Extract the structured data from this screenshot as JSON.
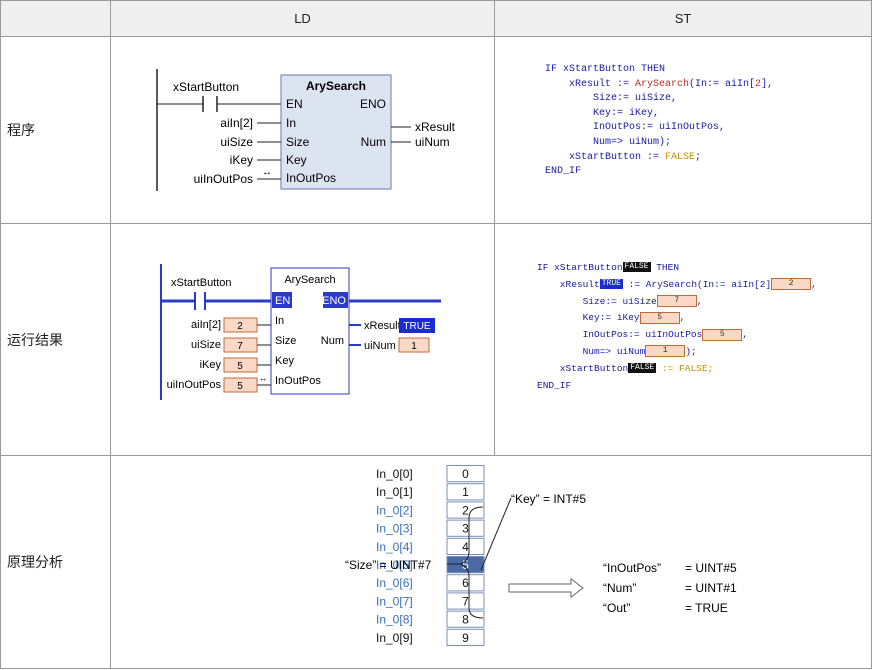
{
  "table": {
    "col_ld": "LD",
    "col_st": "ST",
    "rows": {
      "program": "程序",
      "runtime": "运行结果",
      "analysis": "原理分析"
    }
  },
  "fb": {
    "name": "ArySearch",
    "pin_en": "EN",
    "pin_eno": "ENO",
    "pin_in": "In",
    "pin_size": "Size",
    "pin_key": "Key",
    "pin_inoutpos": "InOutPos",
    "pin_num": "Num",
    "contact": "xStartButton",
    "var_in": "aiIn[2]",
    "var_size": "uiSize",
    "var_key": "iKey",
    "var_inoutpos": "uiInOutPos",
    "var_result": "xResult",
    "var_num": "uiNum",
    "arrow": "↔"
  },
  "runtime_values": {
    "in": "2",
    "size": "7",
    "key": "5",
    "inoutpos": "5",
    "result": "TRUE",
    "num": "1",
    "start": "FALSE"
  },
  "st_program": {
    "l1a": "IF ",
    "l1b": "xStartButton ",
    "l1c": "THEN",
    "l2a": "    xResult := ",
    "l2b": "ArySearch",
    "l2c": "(In:= aiIn[",
    "l2d": "2",
    "l2e": "],",
    "l3": "        Size:= uiSize,",
    "l4": "        Key:= iKey,",
    "l5": "        InOutPos:= uiInOutPos,",
    "l6": "        Num=> uiNum);",
    "l7a": "    xStartButton := ",
    "l7b": "FALSE",
    "l7c": ";",
    "l8": "END_IF"
  },
  "st_runtime": {
    "l1a": "IF xStartButton",
    "l1b": " THEN",
    "l2a": "    xResult",
    "l2b": " := ArySearch(In:= aiIn[2]",
    "l2c": ",",
    "l3a": "        Size:= uiSize",
    "l3b": ",",
    "l4a": "        Key:= iKey",
    "l4b": ",",
    "l5a": "        InOutPos:= uiInOutPos",
    "l5b": ",",
    "l6a": "        Num=> uiNum",
    "l6b": ");",
    "l7a": "    xStartButton",
    "l7b": " := FALSE;",
    "l8": "END_IF"
  },
  "analysis": {
    "array_labels": [
      "In_0[0]",
      "In_0[1]",
      "In_0[2]",
      "In_0[3]",
      "In_0[4]",
      "In_0[5]",
      "In_0[6]",
      "In_0[7]",
      "In_0[8]",
      "In_0[9]"
    ],
    "array_values": [
      "0",
      "1",
      "2",
      "3",
      "4",
      "5",
      "6",
      "7",
      "8",
      "9"
    ],
    "size_note": "“Size” = UINT#7",
    "key_note": "“Key” = INT#5",
    "res1_name": "“InOutPos”",
    "res1_val": "= UINT#5",
    "res2_name": "“Num”",
    "res2_val": "= UINT#1",
    "res3_name": "“Out”",
    "res3_val": "= TRUE",
    "colors": {
      "highlight": "#4a6aa5",
      "blue_label": "#3a6fb8",
      "ladder_blue": "#2a3bc8"
    }
  }
}
